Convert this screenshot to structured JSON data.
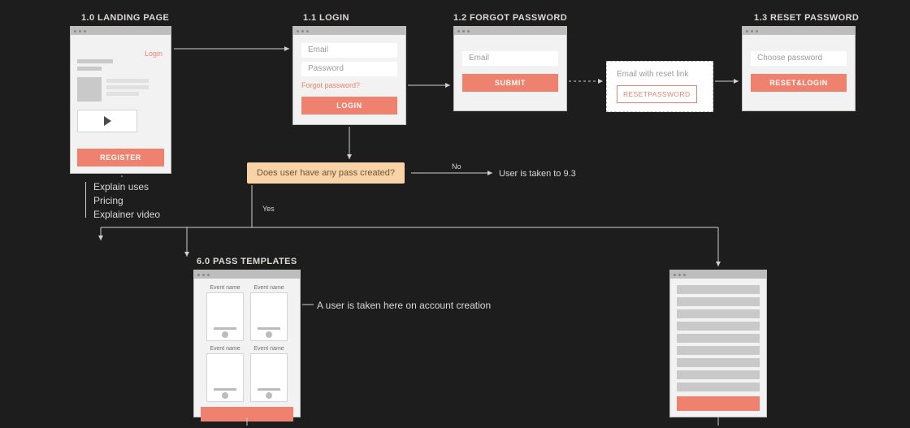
{
  "sections": {
    "landing": {
      "id": "1.0",
      "label": "LANDING PAGE"
    },
    "login": {
      "id": "1.1",
      "label": "LOGIN"
    },
    "forgot": {
      "id": "1.2",
      "label": "FORGOT PASSWORD"
    },
    "reset": {
      "id": "1.3",
      "label": "RESET PASSWORD"
    },
    "templates": {
      "id": "6.0",
      "label": "PASS TEMPLATES"
    }
  },
  "landing": {
    "login_link": "Login",
    "register": "REGISTER",
    "bullets": [
      "Explain uses",
      "Pricing",
      "Explainer video"
    ]
  },
  "login": {
    "email_ph": "Email",
    "password_ph": "Password",
    "forgot": "Forgot password?",
    "submit": "LOGIN"
  },
  "forgot": {
    "email_ph": "Email",
    "submit": "SUBMIT"
  },
  "email": {
    "heading": "Email with reset link",
    "action": "RESETPASSWORD"
  },
  "reset": {
    "password_ph": "Choose password",
    "submit": "RESET&LOGIN"
  },
  "decision": {
    "question": "Does user have any pass created?",
    "yes": "Yes",
    "no": "No",
    "no_result": "User is taken to 9.3"
  },
  "templates": {
    "card_label": "Event name",
    "desc": "A user is taken here on account creation"
  }
}
